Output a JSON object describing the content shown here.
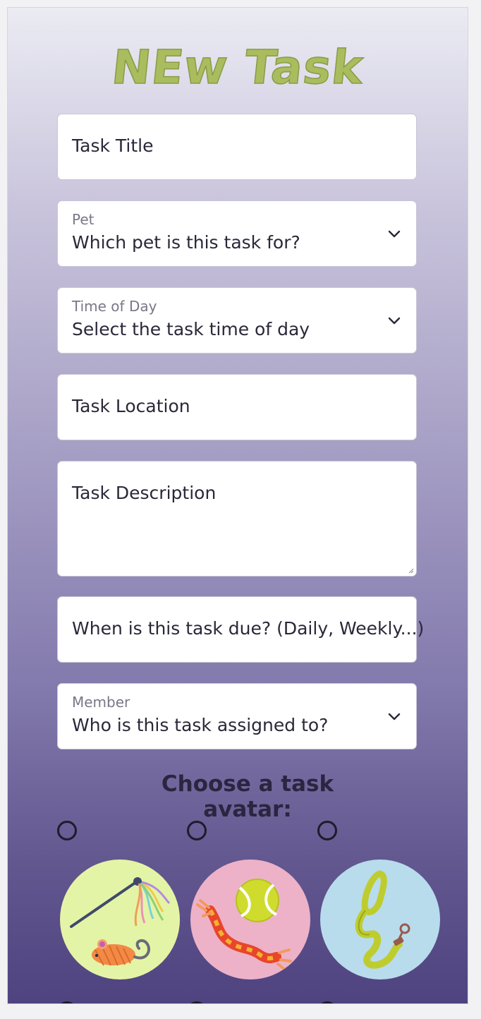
{
  "page": {
    "title": "NEw Task"
  },
  "form": {
    "task_title_placeholder": "Task Title",
    "pet": {
      "label": "Pet",
      "value": "Which pet is this task for?"
    },
    "time_of_day": {
      "label": "Time of Day",
      "value": "Select the task time of day"
    },
    "task_location_placeholder": "Task Location",
    "task_description_placeholder": "Task Description",
    "due_placeholder": "When is this task due? (Daily, Weekly...)",
    "member": {
      "label": "Member",
      "value": "Who is this task assigned to?"
    }
  },
  "avatars": {
    "heading": "Choose a task avatar:",
    "options": [
      {
        "name": "cat-toy-wand-and-mouse-icon",
        "bg": "#e4f4a6"
      },
      {
        "name": "rope-toy-and-tennis-ball-icon",
        "bg": "#edb2c8"
      },
      {
        "name": "leash-icon",
        "bg": "#b8dcec"
      }
    ]
  },
  "colors": {
    "title_green": "#a9bd5f",
    "gradient_top": "#ebebf3",
    "gradient_bottom": "#4f4380",
    "text_dark": "#2a2838",
    "label_gray": "#7a7788"
  }
}
